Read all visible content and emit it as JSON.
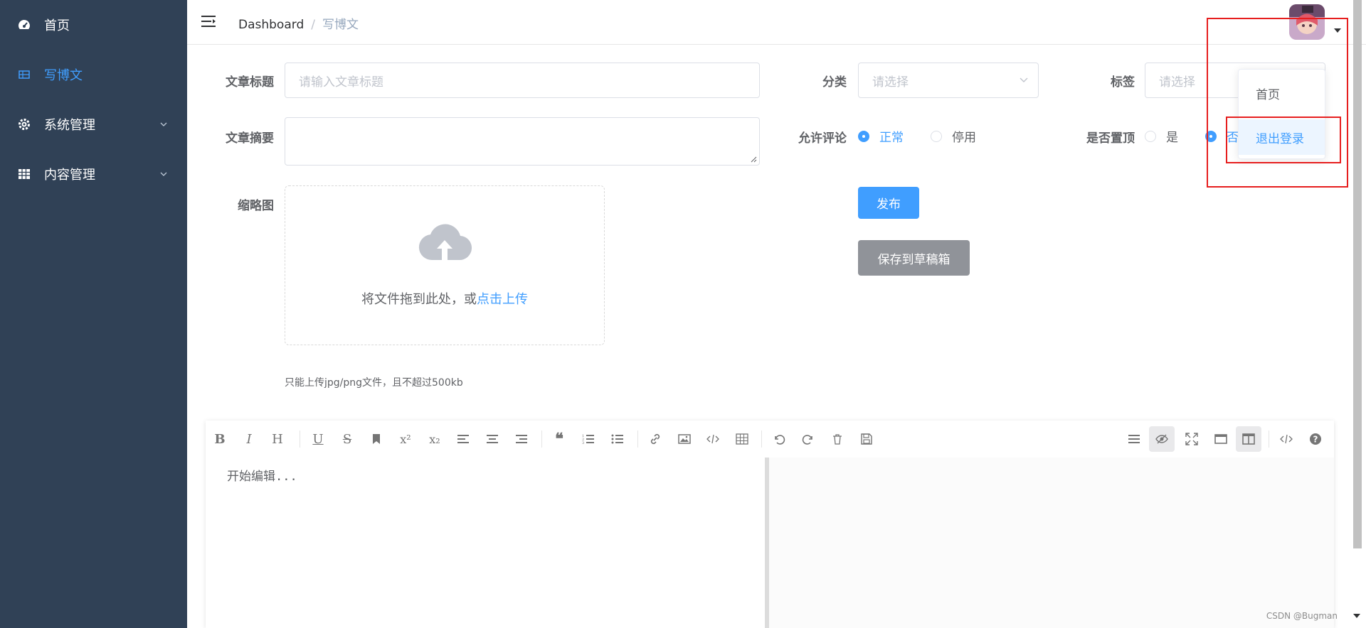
{
  "sidebar": {
    "items": [
      {
        "label": "首页",
        "icon": "dashboard-icon"
      },
      {
        "label": "写博文",
        "icon": "table-icon"
      },
      {
        "label": "系统管理",
        "icon": "gear-icon"
      },
      {
        "label": "内容管理",
        "icon": "grid-icon"
      }
    ]
  },
  "navbar": {
    "breadcrumb": [
      "Dashboard",
      "/",
      "写博文"
    ]
  },
  "form": {
    "title_label": "文章标题",
    "title_placeholder": "请输入文章标题",
    "category_label": "分类",
    "category_placeholder": "请选择",
    "tags_label": "标签",
    "tags_placeholder": "请选择",
    "summary_label": "文章摘要",
    "comment_label": "允许评论",
    "comment_options": [
      "正常",
      "停用"
    ],
    "top_label": "是否置顶",
    "top_options": [
      "是",
      "否"
    ],
    "thumb_label": "缩略图",
    "upload_text": "将文件拖到此处，或",
    "upload_link": "点击上传",
    "upload_tip": "只能上传jpg/png文件，且不超过500kb",
    "publish_button": "发布",
    "draft_button": "保存到草稿箱"
  },
  "editor": {
    "placeholder": "开始编辑...",
    "toolbar": [
      "bold",
      "italic",
      "header",
      "underline",
      "strikethrough",
      "mark",
      "superscript",
      "subscript",
      "align-left",
      "align-center",
      "align-right",
      "quote",
      "ordered-list",
      "unordered-list",
      "link",
      "image",
      "code",
      "table",
      "undo",
      "redo",
      "trash",
      "save",
      "navigation",
      "preview-toggle",
      "fullscreen",
      "read-mode",
      "subfield",
      "html-code",
      "help"
    ]
  },
  "dropdown": {
    "items": [
      "首页",
      "退出登录"
    ]
  },
  "watermark": "CSDN @Bugman"
}
